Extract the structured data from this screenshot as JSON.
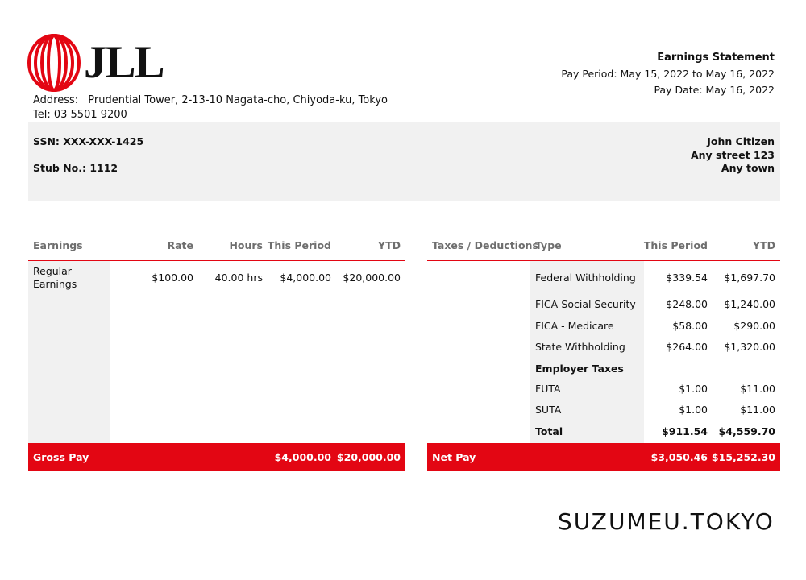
{
  "company": {
    "logo_text": "JLL",
    "address_label": "Address:",
    "address": "Prudential Tower, 2-13-10 Nagata-cho, Chiyoda-ku, Tokyo",
    "tel": "Tel: 03 5501 9200",
    "brand_color": "#e30613"
  },
  "statement": {
    "title": "Earnings Statement",
    "pay_period": "Pay Period: May 15, 2022 to May 16, 2022",
    "pay_date": "Pay Date: May 16, 2022"
  },
  "employee": {
    "ssn": "SSN: XXX-XXX-1425",
    "stub": "Stub No.: 1112",
    "name": "John Citizen",
    "street": "Any street 123",
    "town": "Any town"
  },
  "earnings": {
    "headers": [
      "Earnings",
      "Rate",
      "Hours",
      "This Period",
      "YTD"
    ],
    "rows": [
      {
        "label_line1": "Regular",
        "label_line2": "Earnings",
        "rate": "$100.00",
        "hours": "40.00 hrs",
        "this_period": "$4,000.00",
        "ytd": "$20,000.00"
      }
    ],
    "footer_label": "Gross Pay",
    "footer_this_period": "$4,000.00",
    "footer_ytd": "$20,000.00"
  },
  "taxes": {
    "headers": [
      "Taxes / Deductions",
      "Type",
      "This Period",
      "YTD"
    ],
    "rows": [
      {
        "type": "Federal Withholding",
        "this_period": "$339.54",
        "ytd": "$1,697.70"
      },
      {
        "type": "FICA-Social Security",
        "this_period": "$248.00",
        "ytd": "$1,240.00"
      },
      {
        "type": "FICA - Medicare",
        "this_period": "$58.00",
        "ytd": "$290.00"
      },
      {
        "type": "State Withholding",
        "this_period": "$264.00",
        "ytd": "$1,320.00"
      },
      {
        "type": "Employer Taxes",
        "this_period": "",
        "ytd": ""
      },
      {
        "type": "FUTA",
        "this_period": "$1.00",
        "ytd": "$11.00"
      },
      {
        "type": "SUTA",
        "this_period": "$1.00",
        "ytd": "$11.00"
      },
      {
        "type": "Total",
        "this_period": "$911.54",
        "ytd": "$4,559.70"
      }
    ],
    "footer_label": "Net Pay",
    "footer_this_period": "$3,050.46",
    "footer_ytd": "$15,252.30"
  },
  "watermark": "SUZUMEU.TOKYO"
}
